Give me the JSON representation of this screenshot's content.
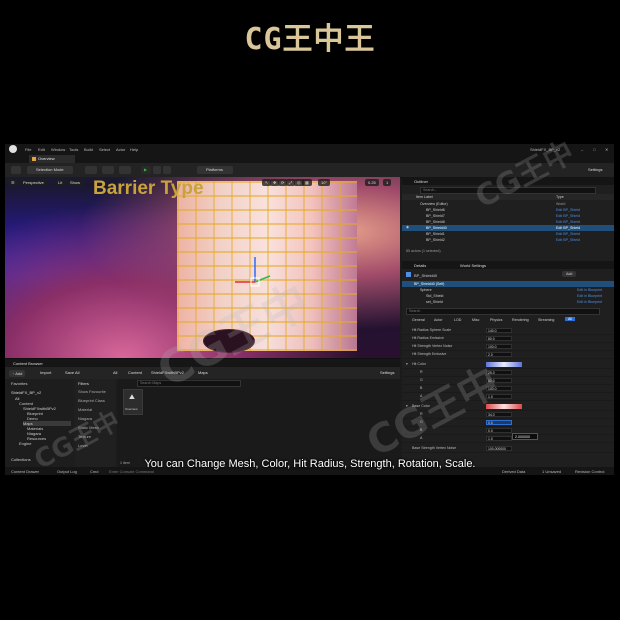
{
  "brand": "CG王中王",
  "watermark_text": "CG王中",
  "subtitle": "You can Change Mesh, Color, Hit Radius, Strength, Rotation, Scale.",
  "window": {
    "title": "ShieldFX_BP_v2",
    "menu": [
      "File",
      "Edit",
      "Window",
      "Tools",
      "Build",
      "Select",
      "Actor",
      "Help"
    ],
    "tab": "Overview",
    "settings_label": "Settings"
  },
  "toolbar": {
    "mode": "Selection Mode",
    "platforms": "Platforms"
  },
  "viewport": {
    "perspective": "Perspective",
    "lit": "Lit",
    "show": "Show",
    "snap_angle": "10°",
    "snap_grid": "0.25",
    "camera_speed": "1",
    "overlay_title": "Barrier Type"
  },
  "content_browser": {
    "title": "Content Browser",
    "add": "Add",
    "import": "Import",
    "save_all": "Save All",
    "path": [
      "All",
      "Content",
      "ShieldFXwithBPv2",
      "Maps"
    ],
    "settings": "Settings",
    "favorites": "Favorites",
    "tree_root": "ShieldFX_BP_v2",
    "tree": [
      "All",
      "Content",
      "ShieldFXwithBPv2",
      "Blueprint",
      "Demo",
      "Maps",
      "Materials",
      "Niagara",
      "Resources",
      "Engine"
    ],
    "filters_label": "Filters",
    "filters": [
      "Show Favourite",
      "Blueprint Class",
      "Material",
      "Niagara",
      "Static Mesh",
      "Texture",
      "Level"
    ],
    "search_placeholder": "Search Maps",
    "asset": "Overview",
    "item_count": "1 item",
    "collections": "Collections"
  },
  "status_bar": {
    "content_drawer": "Content Drawer",
    "output_log": "Output Log",
    "cmd": "Cmd",
    "console_placeholder": "Enter Console Command",
    "derived_data": "Derived Data",
    "unsaved": "1 Unsaved",
    "revision_control": "Revision Control"
  },
  "outliner": {
    "title": "Outliner",
    "search": "Search...",
    "col_item": "Item Label",
    "col_type": "Type",
    "items": [
      {
        "label": "Overview (Editor)",
        "type": "World"
      },
      {
        "label": "BP_Shield6",
        "type": "Edit BP_Shield"
      },
      {
        "label": "BP_Shield7",
        "type": "Edit BP_Shield"
      },
      {
        "label": "BP_Shield8",
        "type": "Edit BP_Shield"
      },
      {
        "label": "BP_Shield40",
        "type": "Edit BP_Shield"
      },
      {
        "label": "BP_Shield1",
        "type": "Edit BP_Shield"
      },
      {
        "label": "BP_Shield2",
        "type": "Edit BP_Shield"
      }
    ],
    "selected_index": 4,
    "footer": "85 actors (1 selected)"
  },
  "details": {
    "tab_details": "Details",
    "tab_world": "World Settings",
    "object": "BP_Shield40",
    "add": "Add",
    "components": [
      {
        "label": "BP_Shield40 (Self)",
        "type": ""
      },
      {
        "label": "Sphere",
        "type": "Edit in Blueprint"
      },
      {
        "label": "Std_Shield",
        "type": "Edit in Blueprint"
      },
      {
        "label": "set_Shield",
        "type": "Edit in Blueprint"
      }
    ],
    "search": "Search",
    "tabs": [
      "General",
      "Actor",
      "LOD",
      "Misc",
      "Physics",
      "Rendering",
      "Streaming",
      "All"
    ],
    "props": [
      {
        "label": "Hit Radius Sphere Scale",
        "value": "140.0"
      },
      {
        "label": "Hit Radius Emissive",
        "value": "80.0"
      },
      {
        "label": "Hit Strength Vertex Noise",
        "value": "100.0"
      },
      {
        "label": "Hit Strength Emissive",
        "value": "2.0"
      }
    ],
    "hit_color": {
      "label": "Hit Color",
      "values": [
        {
          "axis": "R",
          "value": "25.0"
        },
        {
          "axis": "G",
          "value": "80.0"
        },
        {
          "axis": "B",
          "value": "100.0"
        },
        {
          "axis": "A",
          "value": "1.0"
        }
      ]
    },
    "base_color": {
      "label": "Base Color",
      "values": [
        {
          "axis": "R",
          "value": "34.0"
        },
        {
          "axis": "G",
          "value": "0.0"
        },
        {
          "axis": "B",
          "value": "0.0"
        },
        {
          "axis": "A",
          "value": "1.0"
        }
      ]
    },
    "tooltip": "2.000000",
    "last": {
      "label": "Base Strength Vertex Noise",
      "value": "100.000000"
    }
  },
  "colors": {
    "brand": "#d9c79a",
    "selection": "#1f4f7a",
    "play": "#3fae4a",
    "accent": "#2e6fd6",
    "hit_color_swatch": "#6a7fd0",
    "base_color_swatch": "#d8494b"
  }
}
